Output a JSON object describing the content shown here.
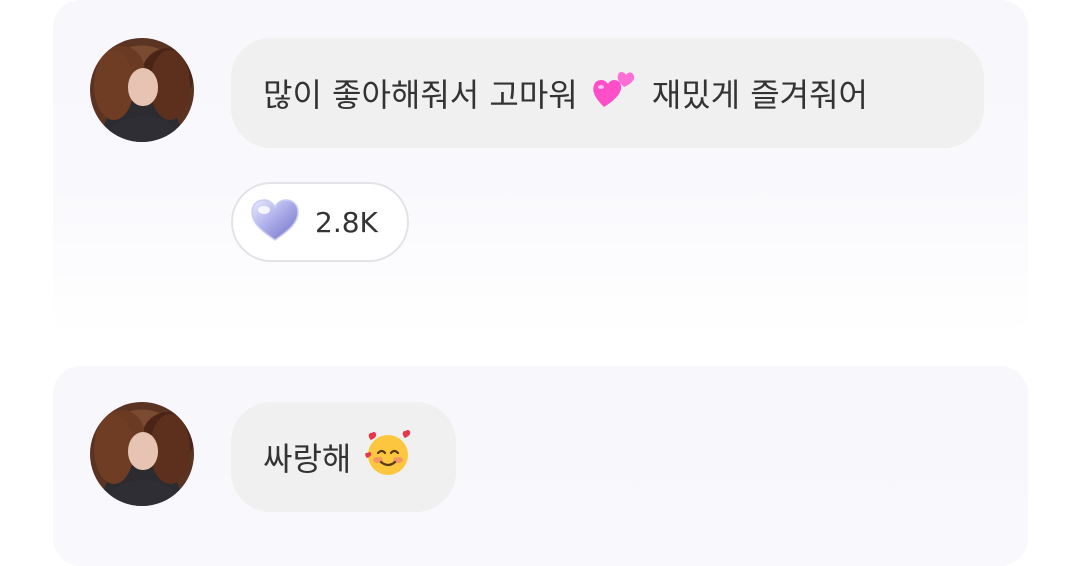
{
  "messages": [
    {
      "text_before": "많이 좋아해줘서 고마워",
      "emoji": "two-hearts",
      "text_after": "재밌게 즐겨줘어",
      "reaction": {
        "icon": "crystal-heart",
        "count": "2.8K"
      }
    },
    {
      "text_before": "싸랑해",
      "emoji": "smiling-face-with-hearts"
    }
  ],
  "colors": {
    "card_background": "#f7f7fc",
    "bubble_background": "#f0f0f0",
    "text": "#333333",
    "reaction_border": "#e2e2e8"
  }
}
